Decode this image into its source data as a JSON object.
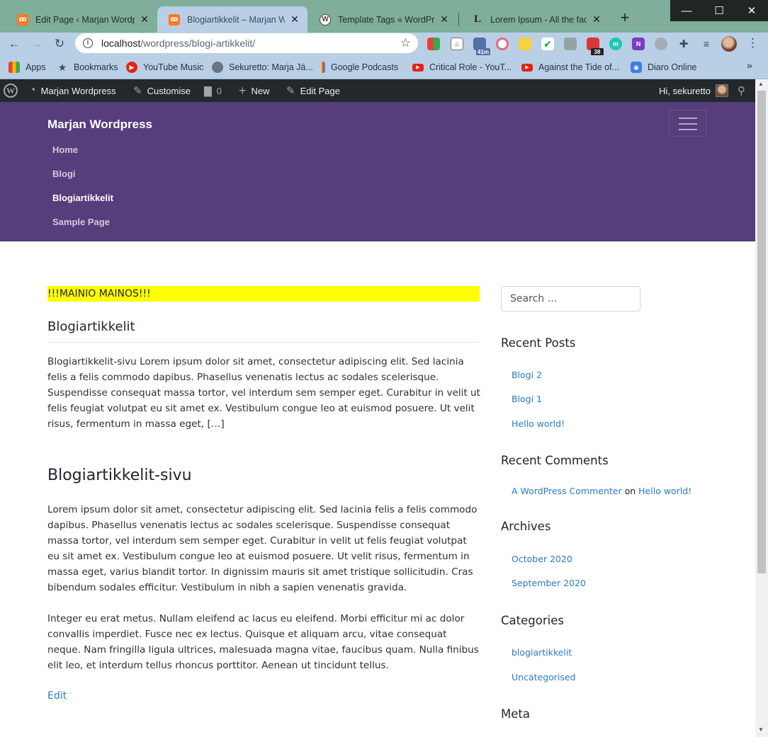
{
  "browser": {
    "tabs": [
      {
        "title": "Edit Page ‹ Marjan Wordpres",
        "favicon": "xampp-favicon",
        "active": false
      },
      {
        "title": "Blogiartikkelit – Marjan Wor",
        "favicon": "xampp-favicon",
        "active": true
      },
      {
        "title": "Template Tags « WordPress",
        "favicon": "wordpress-favicon",
        "active": false
      },
      {
        "title": "Lorem Ipsum - All the facts",
        "favicon": "lipsum-favicon",
        "active": false
      }
    ],
    "tab_close_glyph": "✕",
    "new_tab_glyph": "+",
    "window_controls": {
      "minimize": "—",
      "maximize": "☐",
      "close": "✕"
    },
    "url_host": "localhost",
    "url_path": "/wordpress/blogi-artikkelit/",
    "extension_badges": {
      "timer": "41m",
      "todo": "38"
    },
    "bookmarks": [
      {
        "label": "Apps",
        "icon": "apps-grid-icon"
      },
      {
        "label": "Bookmarks",
        "icon": "star-icon"
      },
      {
        "label": "YouTube Music",
        "icon": "youtube-music-icon"
      },
      {
        "label": "Sekuretto: Marja Jä...",
        "icon": "globe-icon"
      },
      {
        "label": "Google Podcasts",
        "icon": "google-podcasts-icon"
      },
      {
        "label": "Critical Role - YouT...",
        "icon": "youtube-icon"
      },
      {
        "label": "Against the Tide of...",
        "icon": "youtube-icon"
      },
      {
        "label": "Diaro Online",
        "icon": "diaro-icon"
      }
    ],
    "more_glyph": "»"
  },
  "adminbar": {
    "site_name": "Marjan Wordpress",
    "customise": "Customise",
    "comments_count": "0",
    "new": "New",
    "edit_page": "Edit Page",
    "greeting": "Hi, sekuretto"
  },
  "site": {
    "brand": "Marjan Wordpress",
    "nav": [
      "Home",
      "Blogi",
      "Blogiartikkelit",
      "Sample Page"
    ],
    "current_nav": "Blogiartikkelit"
  },
  "content": {
    "ad_text": "!!!MAINIO MAINOS!!!",
    "excerpt_title": "Blogiartikkelit",
    "excerpt_text": "Blogiartikkelit-sivu Lorem ipsum dolor sit amet, consectetur adipiscing elit. Sed lacinia felis a felis commodo dapibus. Phasellus venenatis lectus ac sodales scelerisque. Suspendisse consequat massa tortor, vel interdum sem semper eget. Curabitur in velit ut felis feugiat volutpat eu sit amet ex. Vestibulum congue leo at euismod posuere. Ut velit risus, fermentum in massa eget, […]",
    "page_title": "Blogiartikkelit-sivu",
    "paragraph_1": "Lorem ipsum dolor sit amet, consectetur adipiscing elit. Sed lacinia felis a felis commodo dapibus. Phasellus venenatis lectus ac sodales scelerisque. Suspendisse consequat massa tortor, vel interdum sem semper eget. Curabitur in velit ut felis feugiat volutpat eu sit amet ex. Vestibulum congue leo at euismod posuere. Ut velit risus, fermentum in massa eget, varius blandit tortor. In dignissim mauris sit amet tristique sollicitudin. Cras bibendum sodales efficitur. Vestibulum in nibh a sapien venenatis gravida.",
    "paragraph_2": "Integer eu erat metus. Nullam eleifend ac lacus eu eleifend. Morbi efficitur mi ac dolor convallis imperdiet. Fusce nec ex lectus. Quisque et aliquam arcu, vitae consequat neque. Nam fringilla ligula ultrices, malesuada magna vitae, faucibus quam. Nulla finibus elit leo, et interdum tellus rhoncus porttitor. Aenean ut tincidunt tellus.",
    "edit_link": "Edit"
  },
  "sidebar": {
    "search_placeholder": "Search …",
    "recent_posts_title": "Recent Posts",
    "recent_posts": [
      "Blogi 2",
      "Blogi 1",
      "Hello world!"
    ],
    "recent_comments_title": "Recent Comments",
    "comment_author": "A WordPress Commenter",
    "comment_on": "on",
    "comment_post": "Hello world!",
    "archives_title": "Archives",
    "archives": [
      "October 2020",
      "September 2020"
    ],
    "categories_title": "Categories",
    "categories": [
      "blogiartikkelit",
      "Uncategorised"
    ],
    "meta_title": "Meta"
  },
  "colors": {
    "header_purple": "#563d7c",
    "adminbar": "#23282d",
    "link_blue": "#2a7ac9",
    "ad_yellow": "#ffff00",
    "chrome_tabstrip": "#7fae9a",
    "chrome_toolbar": "#b9cfe6"
  }
}
